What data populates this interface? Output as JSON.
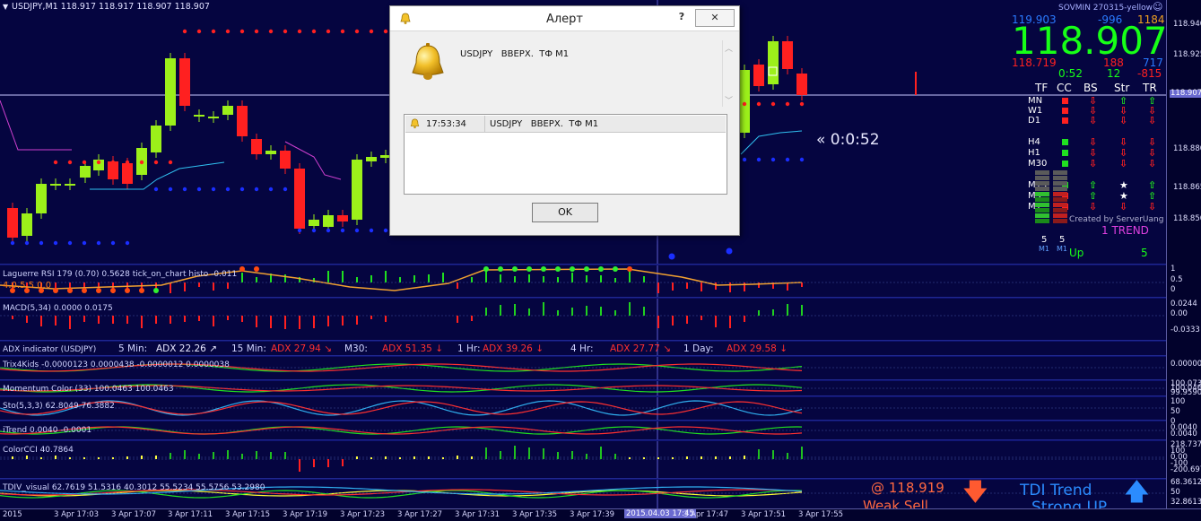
{
  "symbol_label": "USDJPY,M1  118.917 118.917 118.907 118.907",
  "colors": {
    "bg": "#050540",
    "bull": "#9cf01a",
    "bear": "#ff2020",
    "dot_red": "#ff2020",
    "dot_blue": "#1a2eff",
    "magenta": "#d040d0",
    "cyan": "#30c0f0",
    "price_line": "#c8c8ff"
  },
  "price_axis": {
    "labels": [
      "118.940",
      "118.925",
      "118.907",
      "118.880",
      "118.865",
      "118.850"
    ],
    "current": "118.907"
  },
  "indicators": {
    "laguerre": {
      "label": "Laguerre RSI 179 (0.70) 0.5628  tick_on_chart histo -0.011",
      "axis": [
        "1",
        "0.5",
        "0"
      ],
      "badge": "4.0.5.5 0.0"
    },
    "macd": {
      "label": "MACD(5,34) 0.0000 0.0175",
      "axis": [
        "0.0244",
        "0.00",
        "-0.0333"
      ]
    },
    "adx": {
      "label": "ADX indicator (USDJPY)",
      "items": [
        {
          "tf": "5 Min:",
          "val": "ADX 22.26",
          "arrow": "↗",
          "c": "#e8e8ff"
        },
        {
          "tf": "15 Min:",
          "val": "ADX 27.94",
          "arrow": "↘",
          "c": "#ff3030"
        },
        {
          "tf": "M30:",
          "val": "ADX 51.35",
          "arrow": "↓",
          "c": "#ff3030"
        },
        {
          "tf": "1 Hr:",
          "val": "ADX 39.26",
          "arrow": "↓",
          "c": "#ff3030"
        },
        {
          "tf": "4 Hr:",
          "val": "ADX 27.77",
          "arrow": "↘",
          "c": "#ff3030"
        },
        {
          "tf": "1 Day:",
          "val": "ADX 29.58",
          "arrow": "↓",
          "c": "#ff3030"
        }
      ]
    },
    "trix": {
      "label": "Trix4Kids -0.0000123 0.0000438 -0.0000012 0.0000038",
      "axis": [
        "0.00000"
      ]
    },
    "momentum": {
      "label": "Momentum Color (33) 100.0463 100.0463",
      "axis": [
        "100.0730",
        "100.0463",
        "99.9590"
      ]
    },
    "sto": {
      "label": "Sto(5,3,3) 62.8049 76.3882",
      "axis": [
        "100",
        "50",
        "0"
      ]
    },
    "itrend": {
      "label": "iTrend 0.0040 -0.0001",
      "axis": [
        "0.0040",
        "0.0040"
      ]
    },
    "cci": {
      "label": "ColorCCI 40.7864",
      "axis": [
        "218.7377",
        "100",
        "0.00",
        "-100",
        "-200.6976"
      ]
    },
    "tdi": {
      "label": "TDIV_visual 62.7619 51.5316 40.3012 55.5234 55.5756 53.2980",
      "axis": [
        "68.3612",
        "50",
        "32.8613"
      ]
    }
  },
  "panel": {
    "header": "SOVMIN 270315-yellow",
    "big_price": "118.907",
    "row1": [
      "119.903",
      "-996",
      "1184"
    ],
    "row2": [
      "118.719",
      "188",
      "717"
    ],
    "row3": [
      "0:52",
      "12",
      "-815"
    ],
    "cols": [
      "TF",
      "CC",
      "BS",
      "Str",
      "TR"
    ],
    "tfs": [
      "MN",
      "W1",
      "D1",
      "H4",
      "H1",
      "M30",
      "M15",
      "M5",
      "M1"
    ],
    "created": "Created by ServerUang",
    "trend": "1 TREND",
    "bottom_nums": [
      "5",
      "5"
    ],
    "bottom_tfs": [
      "M1",
      "M1"
    ],
    "up_label": "Up",
    "up_val": "5"
  },
  "countdown": "« 0:0:52",
  "sell": {
    "price": "@ 118.919",
    "text": "Weak Sell"
  },
  "tdi_trend": {
    "text1": "TDI Trend",
    "text2": "Strong UP"
  },
  "time_axis": [
    "2015",
    "3 Apr 17:03",
    "3 Apr 17:07",
    "3 Apr 17:11",
    "3 Apr 17:15",
    "3 Apr 17:19",
    "3 Apr 17:23",
    "3 Apr 17:27",
    "3 Apr 17:31",
    "3 Apr 17:35",
    "3 Apr 17:39",
    "2015.04.03 17:45",
    "3 Apr 17:47",
    "3 Apr 17:51",
    "3 Apr 17:55"
  ],
  "dialog": {
    "title": "Алерт",
    "help": "?",
    "close": "✕",
    "message": "USDJPY   ВВЕРХ.  ТФ M1",
    "list_time": "17:53:34",
    "list_message": "USDJPY   ВВЕРХ.  ТФ M1",
    "ok": "OK"
  }
}
